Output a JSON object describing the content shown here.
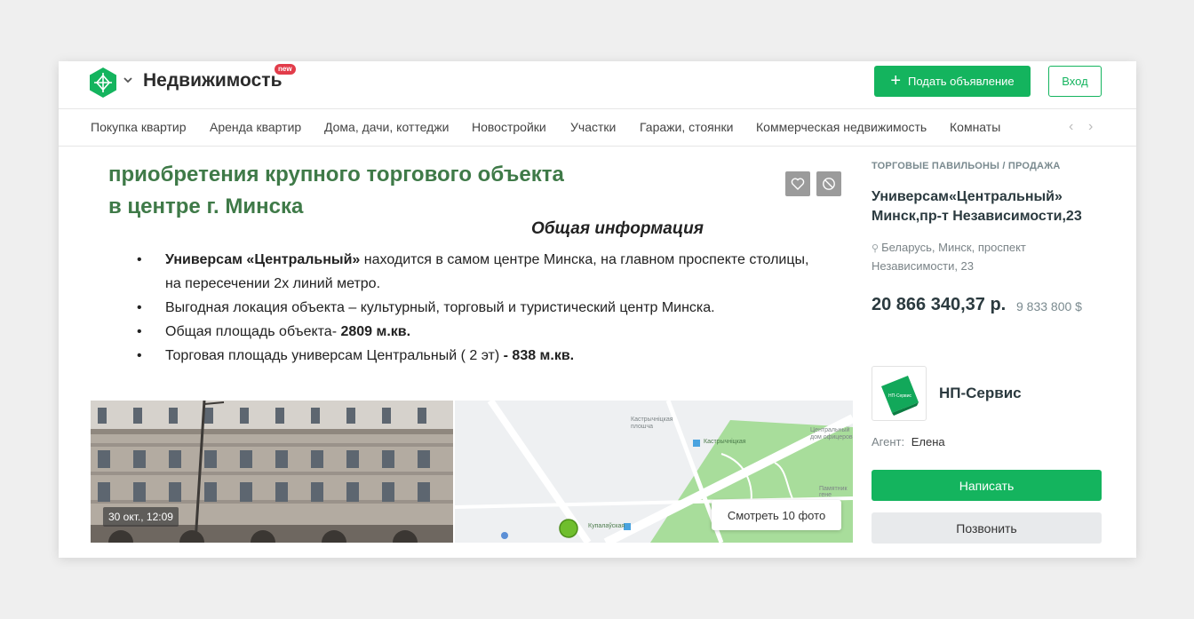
{
  "header": {
    "brand": "Недвижимость",
    "new_badge": "new",
    "post_button": "Подать объявление",
    "login_button": "Вход"
  },
  "nav": {
    "items": [
      "Покупка квартир",
      "Аренда квартир",
      "Дома, дачи, коттеджи",
      "Новостройки",
      "Участки",
      "Гаражи, стоянки",
      "Коммерческая недвижимость",
      "Комнаты"
    ]
  },
  "photo": {
    "slide_heading_line1": "приобретения крупного торгового объекта",
    "slide_heading_line2": "в центре г. Минска",
    "slide_subheading": "Общая информация",
    "bullets": [
      {
        "bold": "Универсам «Центральный»",
        "text": " находится в самом центре Минска, на главном проспекте столицы, на пересечении 2х линий метро."
      },
      {
        "bold": "",
        "text": "Выгодная локация объекта – культурный, торговый и туристический центр Минска."
      },
      {
        "bold": "2809 м.кв.",
        "text": "Общая площадь объекта- "
      },
      {
        "bold": "- 838 м.кв.",
        "text": "Торговая площадь универсам Центральный ( 2 эт) "
      }
    ],
    "date": "30 окт., 12:09",
    "more_photos": "Смотреть 10 фото",
    "map_labels": [
      "Кастрычніцкая плошча",
      "Кастрычніцкая",
      "Купалаўская",
      "Центральный дом офицеров",
      "Памятник гене"
    ]
  },
  "listing": {
    "category": "Торговые павильоны / Продажа",
    "title": "Универсам«Центральный» Минск,пр-т Независимости,23",
    "address": "Беларусь, Минск, проспект Независимости, 23",
    "price_byn": "20 866 340,37 р.",
    "price_usd": "9 833 800 $",
    "seller_name": "НП-Сервис",
    "seller_logo_text": "НП-Сервис",
    "agent_label": "Агент:",
    "agent_name": "Елена",
    "write_button": "Написать",
    "call_button": "Позвонить"
  },
  "colors": {
    "accent": "#14b45e",
    "new_badge": "#e23c4a",
    "slide_heading": "#3f7a48"
  },
  "icons": [
    "logo-icon",
    "chevron-down-icon",
    "plus-icon",
    "heart-icon",
    "block-icon",
    "chevron-left-icon",
    "chevron-right-icon",
    "location-pin-icon"
  ]
}
